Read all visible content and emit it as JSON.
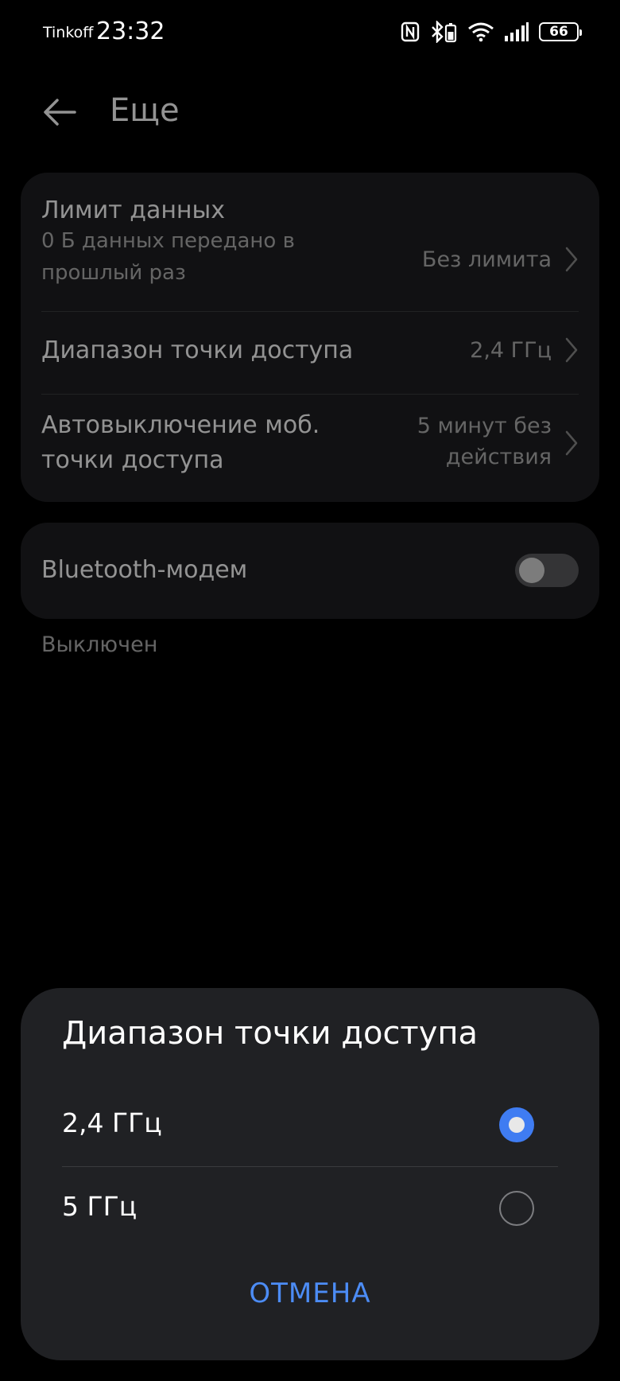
{
  "status_bar": {
    "carrier": "Tinkoff",
    "time": "23:32",
    "battery": "66",
    "icons": [
      "nfc-icon",
      "bluetooth-battery-icon",
      "wifi-icon",
      "signal-icon",
      "battery-icon"
    ]
  },
  "header": {
    "title": "Еще",
    "back_icon": "arrow-left-icon"
  },
  "settings": {
    "data_limit": {
      "title": "Лимит данных",
      "subtitle_line1": "0 Б данных передано в",
      "subtitle_line2": "прошлый раз",
      "value": "Без лимита"
    },
    "ap_band": {
      "title": "Диапазон точки доступа",
      "value": "2,4 ГГц"
    },
    "auto_off": {
      "title_line1": "Автовыключение моб.",
      "title_line2": "точки доступа",
      "value_line1": "5 минут без",
      "value_line2": "действия"
    },
    "bluetooth_modem": {
      "title": "Bluetooth-модем",
      "enabled": false,
      "status": "Выключен"
    }
  },
  "dialog": {
    "title": "Диапазон точки доступа",
    "options": [
      {
        "label": "2,4 ГГц",
        "selected": true
      },
      {
        "label": "5 ГГц",
        "selected": false
      }
    ],
    "cancel_label": "ОТМЕНА"
  },
  "colors": {
    "accent": "#3f7cf2",
    "cancel_text": "#4c8cf5",
    "card_bg": "#1e1f21",
    "sheet_bg": "#202124"
  }
}
